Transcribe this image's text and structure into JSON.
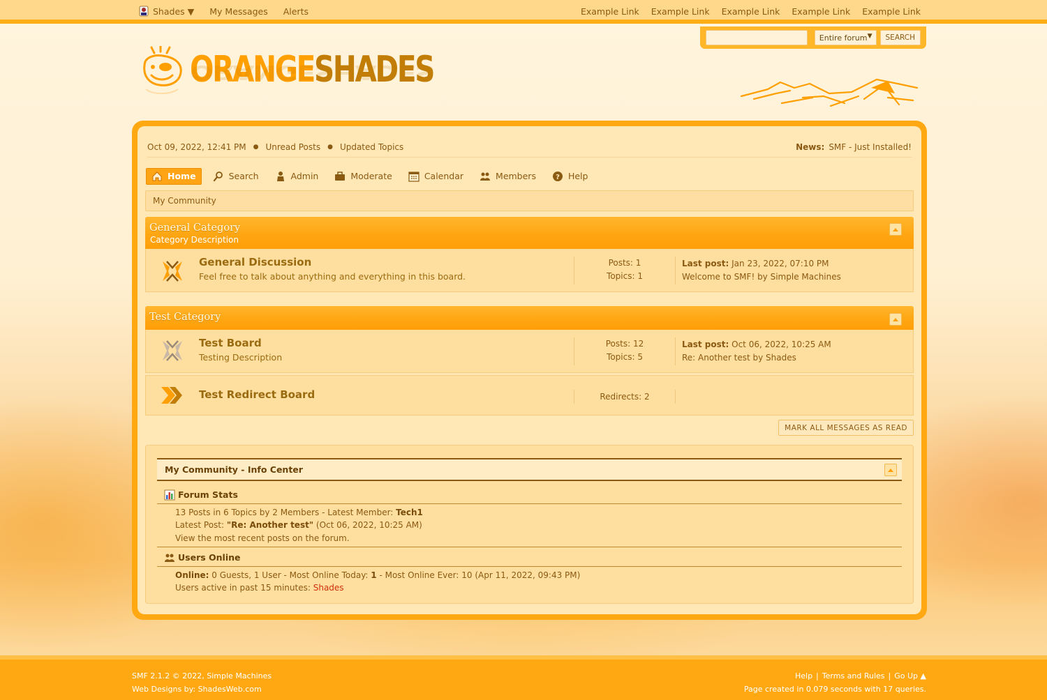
{
  "topbar": {
    "user_label": "Shades ▼",
    "left_items": [
      "My Messages",
      "Alerts"
    ],
    "right_links": [
      "Example Link",
      "Example Link",
      "Example Link",
      "Example Link",
      "Example Link"
    ]
  },
  "search": {
    "input_value": "",
    "scope": "Entire forum",
    "button": "SEARCH"
  },
  "logo": {
    "part1": "ORANGE",
    "part2": "SHADES"
  },
  "infobar": {
    "datetime": "Oct 09, 2022, 12:41 PM",
    "unread": "Unread Posts",
    "updated": "Updated Topics",
    "news_label": "News:",
    "news_text": "SMF - Just Installed!"
  },
  "menu": {
    "items": [
      {
        "label": "Home",
        "icon": "home-icon"
      },
      {
        "label": "Search",
        "icon": "search-icon"
      },
      {
        "label": "Admin",
        "icon": "admin-icon"
      },
      {
        "label": "Moderate",
        "icon": "moderate-icon"
      },
      {
        "label": "Calendar",
        "icon": "calendar-icon"
      },
      {
        "label": "Members",
        "icon": "members-icon"
      },
      {
        "label": "Help",
        "icon": "help-icon"
      }
    ]
  },
  "breadcrumb": "My Community",
  "categories": [
    {
      "title": "General Category",
      "description": "Category Description",
      "boards": [
        {
          "name": "General Discussion",
          "description": "Feel free to talk about anything and everything in this board.",
          "stat1": "Posts: 1",
          "stat2": "Topics: 1",
          "lastpost_label": "Last post:",
          "lastpost_date": "Jan 23, 2022, 07:10 PM",
          "lastpost_topic": "Welcome to SMF! by Simple Machines"
        }
      ]
    },
    {
      "title": "Test Category",
      "description": "",
      "boards": [
        {
          "name": "Test Board",
          "description": "Testing Description",
          "stat1": "Posts: 12",
          "stat2": "Topics: 5",
          "lastpost_label": "Last post:",
          "lastpost_date": "Oct 06, 2022, 10:25 AM",
          "lastpost_topic": "Re: Another test by Shades"
        },
        {
          "name": "Test Redirect Board",
          "description": "",
          "stat1": "Redirects: 2"
        }
      ]
    }
  ],
  "mark_read": "MARK ALL MESSAGES AS READ",
  "info_center": {
    "title": "My Community - Info Center",
    "stats_title": "Forum Stats",
    "stats_line1_pre": "13 Posts in 6 Topics by 2 Members - Latest Member: ",
    "stats_latest_member": "Tech1",
    "stats_line2_pre": "Latest Post: ",
    "stats_latest_post": "\"Re: Another test\"",
    "stats_line2_post": " (Oct 06, 2022, 10:25 AM)",
    "stats_line3": "View the most recent posts on the forum.",
    "online_title": "Users Online",
    "online_label": "Online:",
    "online_text1": " 0 Guests, 1 User  - Most Online Today: ",
    "online_today": "1",
    "online_text2": " -  Most Online Ever: 10 (Apr 11, 2022, 09:43 PM)",
    "active_pre": "Users active in past 15 minutes: ",
    "active_user": "Shades"
  },
  "footer": {
    "line1": "SMF 2.1.2 © 2022, Simple Machines",
    "line2": "Web Designs by: ShadesWeb.com",
    "links": [
      "Help",
      "Terms and Rules",
      "Go Up ▲"
    ],
    "page_created": "Page created in 0.079 seconds with 17 queries."
  },
  "colors": {
    "accent": "#ffa812",
    "panel": "#ffe7b6",
    "text": "#8a5a12",
    "online_user": "#d12f0b"
  }
}
